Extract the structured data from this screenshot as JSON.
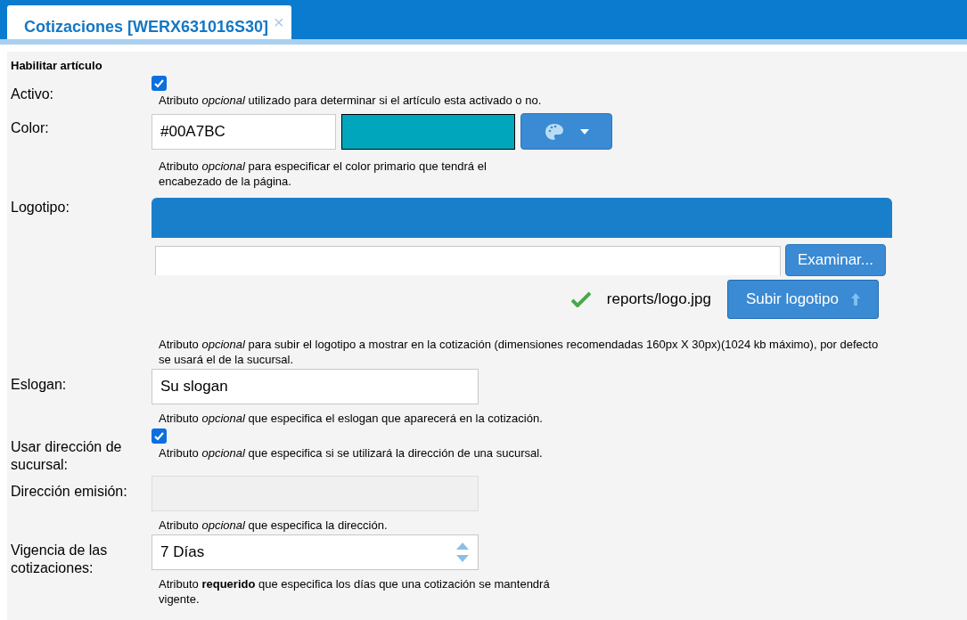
{
  "tabs": [
    {
      "label": "Cotizaciones [WERX631016S30]",
      "selected": true,
      "close": "×"
    }
  ],
  "section_title": "Habilitar artículo",
  "fields": [
    {
      "kind": "checkbox",
      "label": "Activo:",
      "checked": true,
      "help": "Atributo *opcional* utilizado para determinar si el artículo esta activado o no."
    },
    {
      "kind": "color",
      "label": "Color:",
      "value": "#00A7BC",
      "help": "Atributo *opcional* para especificar el color primario que tendrá el encabezado de la página."
    },
    {
      "kind": "logo",
      "label": "Logotipo:",
      "browse_button": "Examinar...",
      "uploaded_file": "reports/logo.jpg",
      "upload_button": "Subir logotipo",
      "help": "Atributo *opcional* para subir el logotipo a mostrar en la cotización (dimensiones recomendadas 160px X 30px)(1024 kb máximo), por defecto se usará el de la sucursal."
    },
    {
      "kind": "text",
      "label": "Eslogan:",
      "value": "Su slogan",
      "help": "Atributo *opcional* que especifica el eslogan que aparecerá en la cotización."
    },
    {
      "kind": "checkbox",
      "label": "Usar dirección de sucursal:",
      "checked": true,
      "help": "Atributo *opcional* que especifica si se utilizará la dirección de una sucursal."
    },
    {
      "kind": "text",
      "label": "Dirección emisión:",
      "disabled": true,
      "help": "Atributo *opcional* que especifica la dirección."
    },
    {
      "kind": "spinner",
      "label": "Vigencia de las cotizaciones:",
      "value": "7 Días",
      "help": "Atributo **requerido** que especifica los días que una cotización se mantendrá vigente."
    }
  ]
}
